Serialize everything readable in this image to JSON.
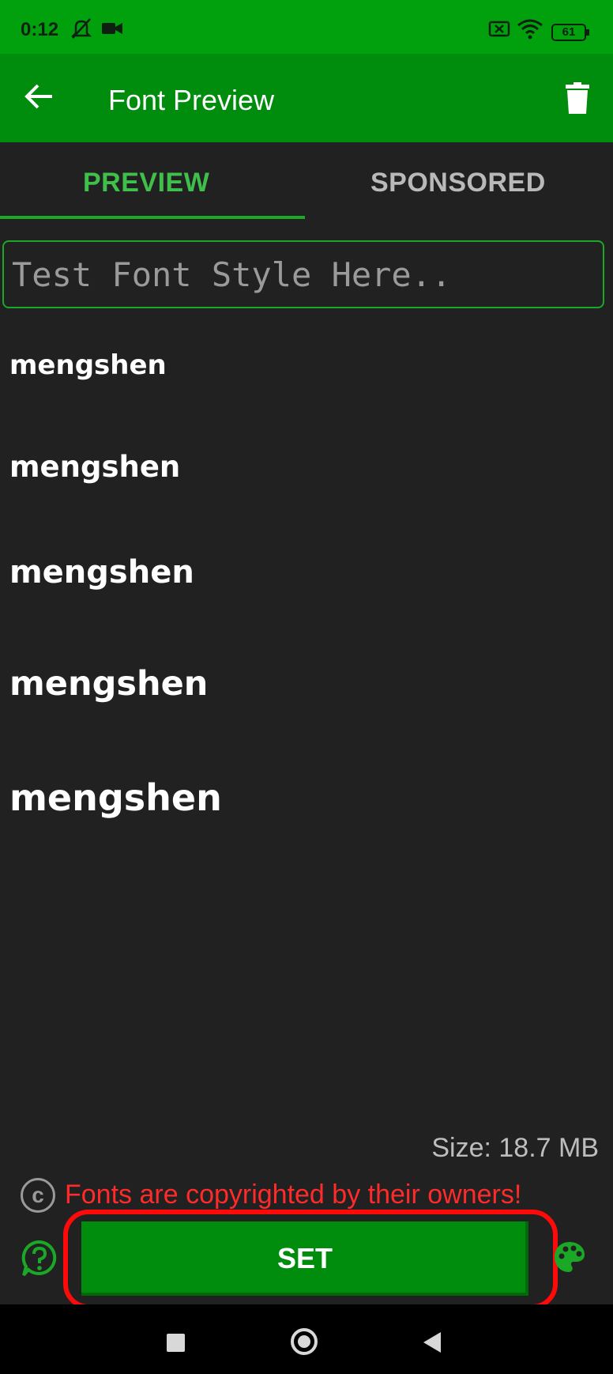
{
  "status_bar": {
    "time": "0:12",
    "icons": [
      "mute-bell-icon",
      "video-camera-icon",
      "sim-x-icon",
      "wifi-icon",
      "battery-icon"
    ],
    "battery_level": "61"
  },
  "app_bar": {
    "title": "Font Preview",
    "back_icon": "arrow-left-icon",
    "delete_icon": "trash-icon"
  },
  "tabs": [
    {
      "label": "PREVIEW",
      "selected": true
    },
    {
      "label": "SPONSORED",
      "selected": false
    }
  ],
  "input": {
    "placeholder": "Test Font Style Here..",
    "value": ""
  },
  "samples": [
    "mengshen",
    "mengshen",
    "mengshen",
    "mengshen",
    "mengshen"
  ],
  "size_text": "Size: 18.7 MB",
  "copyright_text": "Fonts are copyrighted by their owners!",
  "copyright_icon": "c",
  "set_button": "SET",
  "colors": {
    "status_bar": "#00a10d",
    "app_bar": "#008c0c",
    "accent": "#1aa826",
    "warning": "#ff2a2a",
    "highlight_frame": "#ff0a0a",
    "background": "#212121"
  }
}
